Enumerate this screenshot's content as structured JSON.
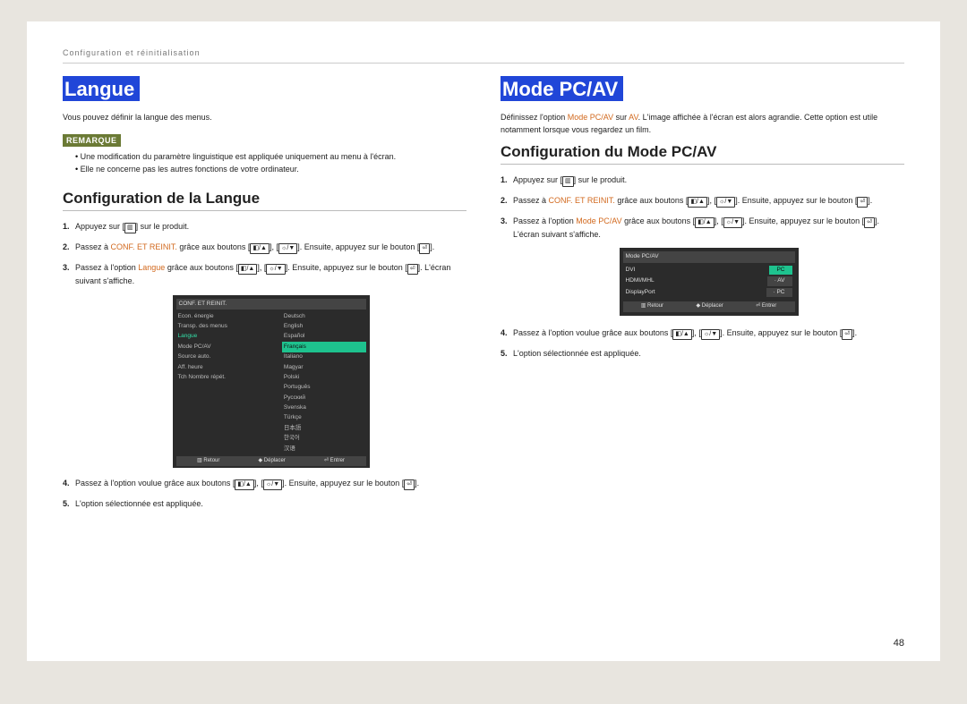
{
  "header": {
    "breadcrumb": "Configuration et réinitialisation"
  },
  "left": {
    "title": "Langue",
    "intro": "Vous pouvez définir la langue des menus.",
    "noteBadge": "REMARQUE",
    "notes": [
      "Une modification du paramètre linguistique est appliquée uniquement au menu à l'écran.",
      "Elle ne concerne pas les autres fonctions de votre ordinateur."
    ],
    "section": "Configuration de la Langue",
    "steps": {
      "s1a": "Appuyez sur [",
      "s1b": "] sur le produit.",
      "s2a": "Passez à ",
      "s2link": "CONF. ET REINIT.",
      "s2b": " grâce aux boutons [",
      "s2c": "], [",
      "s2d": "]. Ensuite, appuyez sur le bouton [",
      "s2e": "].",
      "s3a": "Passez à l'option ",
      "s3link": "Langue",
      "s3b": " grâce aux boutons [",
      "s3c": "], [",
      "s3d": "]. Ensuite, appuyez sur le bouton [",
      "s3e": "]. L'écran suivant s'affiche.",
      "s4a": "Passez à l'option voulue grâce aux boutons [",
      "s4b": "], [",
      "s4c": "]. Ensuite, appuyez sur le bouton [",
      "s4d": "].",
      "s5": "L'option sélectionnée est appliquée."
    },
    "osd": {
      "title": "CONF. ET REINIT.",
      "leftItems": [
        "Econ. énergie",
        "Transp. des menus",
        "Langue",
        "Mode PC/AV",
        "Source auto.",
        "Aff. heure",
        "Tch Nombre répét."
      ],
      "rightItems": [
        "Deutsch",
        "English",
        "Español",
        "Français",
        "Italiano",
        "Magyar",
        "Polski",
        "Português",
        "Русский",
        "Svenska",
        "Türkçe",
        "日本語",
        "한국어",
        "汉语"
      ],
      "highlightedLeft": "Langue",
      "selectedRight": "Français",
      "foot": [
        "▥ Retour",
        "◆ Déplacer",
        "⏎ Entrer"
      ]
    }
  },
  "right": {
    "title": "Mode PC/AV",
    "intro1": "Définissez l'option ",
    "introLink1": "Mode PC/AV",
    "intro2": " sur ",
    "introLink2": "AV",
    "intro3": ". L'image affichée à l'écran est alors agrandie. Cette option est utile notamment lorsque vous regardez un film.",
    "section": "Configuration du Mode PC/AV",
    "steps": {
      "s1a": "Appuyez sur [",
      "s1b": "] sur le produit.",
      "s2a": "Passez à ",
      "s2link": "CONF. ET REINIT.",
      "s2b": " grâce aux boutons [",
      "s2c": "], [",
      "s2d": "]. Ensuite, appuyez sur le bouton [",
      "s2e": "].",
      "s3a": "Passez à l'option ",
      "s3link": "Mode PC/AV",
      "s3b": " grâce aux boutons [",
      "s3c": "], [",
      "s3d": "]. Ensuite, appuyez sur le bouton [",
      "s3e": "]. L'écran suivant s'affiche.",
      "s4a": "Passez à l'option voulue grâce aux boutons [",
      "s4b": "], [",
      "s4c": "]. Ensuite, appuyez sur le bouton [",
      "s4d": "].",
      "s5": "L'option sélectionnée est appliquée."
    },
    "osd": {
      "title": "Mode PC/AV",
      "rows": [
        {
          "label": "DVI",
          "value": "PC",
          "sel": true
        },
        {
          "label": "HDMI/MHL",
          "value": "AV",
          "sel": false
        },
        {
          "label": "DisplayPort",
          "value": "PC",
          "sel": false
        }
      ],
      "foot": [
        "▥ Retour",
        "◆ Déplacer",
        "⏎ Entrer"
      ]
    }
  },
  "pageNumber": "48",
  "symbols": {
    "menu": "▥",
    "volUp": "◧/▲",
    "brDn": "☼/▼",
    "enter": "⏎"
  }
}
